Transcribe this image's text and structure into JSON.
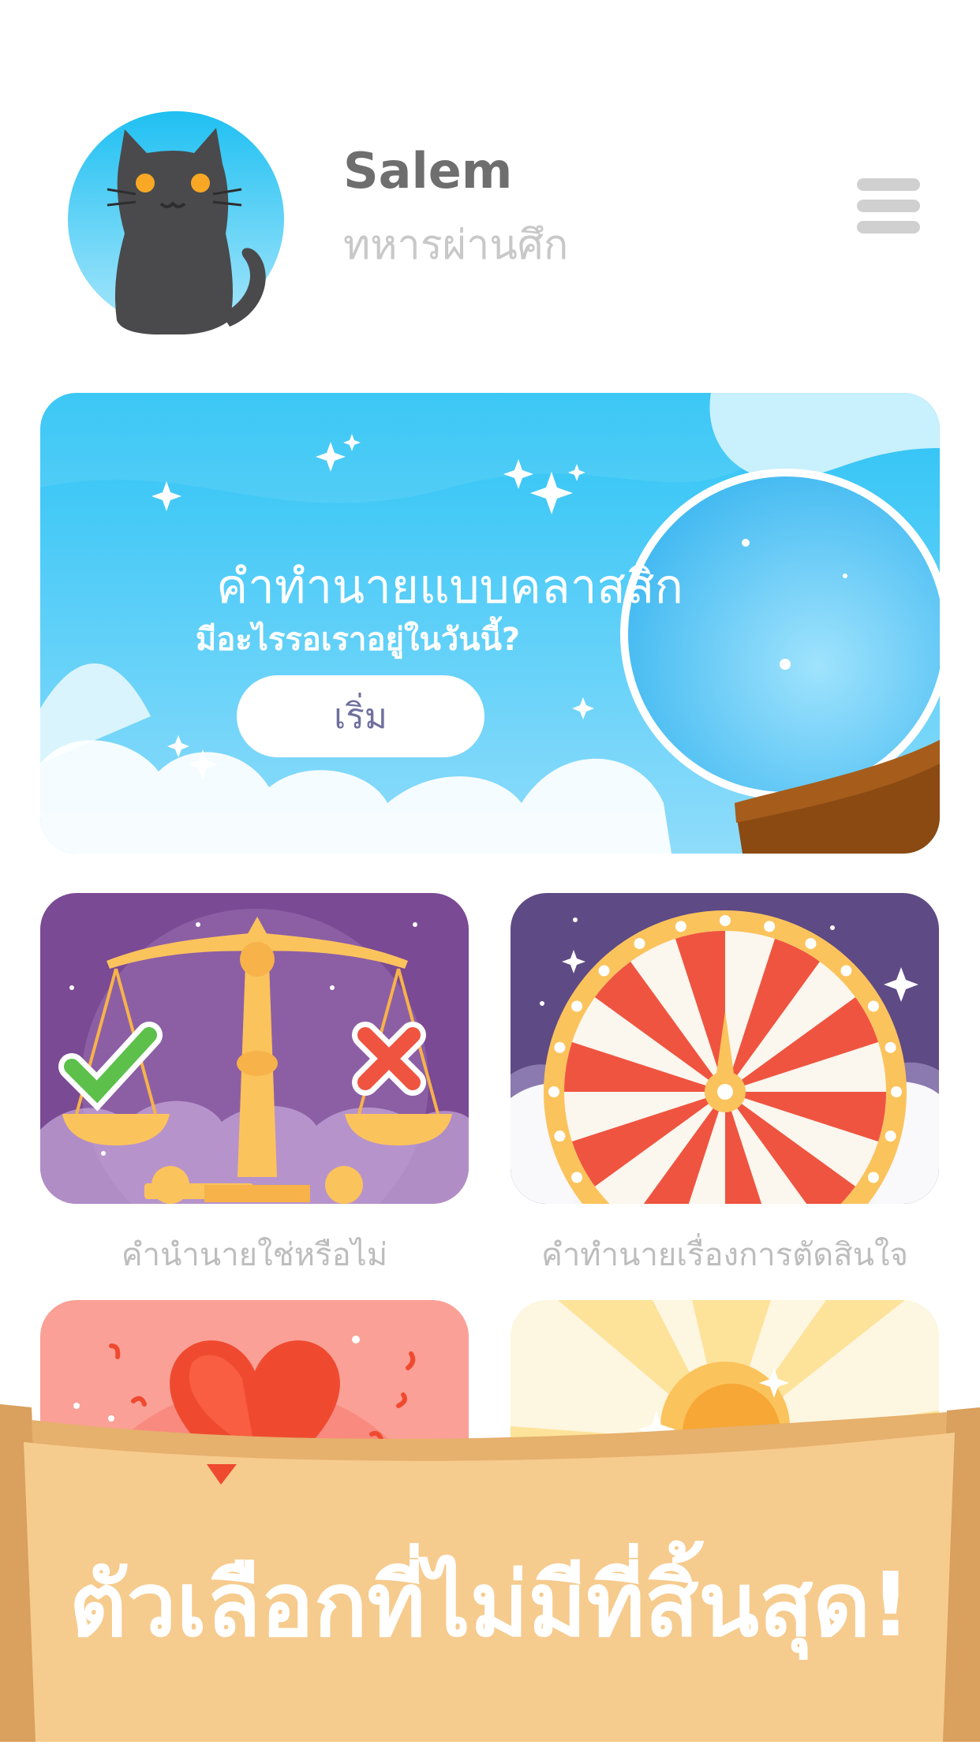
{
  "header": {
    "user_name": "Salem",
    "user_subtitle": "ทหารผ่านศึก",
    "avatar_icon": "black-cat-icon",
    "menu_icon": "hamburger-menu-icon"
  },
  "classic_card": {
    "title": "คำทำนายแบบคลาสสิก",
    "subtitle": "มีอะไรรอเราอยู่ในวันนี้?",
    "start_label": "เริ่ม",
    "icon": "crystal-ball-icon"
  },
  "cards": [
    {
      "label": "คำนำนายใช่หรือไม่",
      "icon": "scales-icon"
    },
    {
      "label": "คำทำนายเรื่องการตัดสินใจ",
      "icon": "fortune-wheel-icon"
    },
    {
      "label": "",
      "icon": "heart-icon"
    },
    {
      "label": "",
      "icon": "sun-icon"
    }
  ],
  "promo": {
    "text": "ตัวเลือกที่ไม่มีที่สิ้นสุด!"
  },
  "colors": {
    "sky": "#4dc6f2",
    "purple": "#7b4a94",
    "wheel_red": "#ef5440",
    "gold": "#fbc35c",
    "promo_paper": "#f6cb8e"
  }
}
